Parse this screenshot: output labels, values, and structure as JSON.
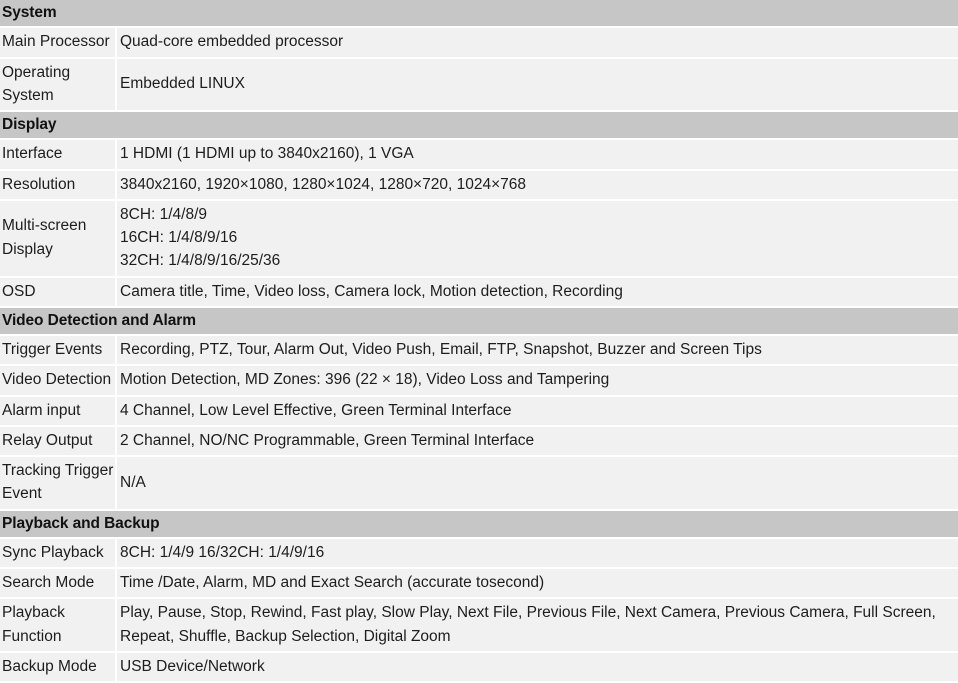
{
  "table": {
    "rows": [
      {
        "kind": "section",
        "title": "System"
      },
      {
        "kind": "data",
        "label": "Main Processor",
        "value": "Quad-core embedded processor"
      },
      {
        "kind": "data",
        "label": "Operating System",
        "value": "Embedded LINUX"
      },
      {
        "kind": "section",
        "title": "Display"
      },
      {
        "kind": "data",
        "label": "Interface",
        "value": "1 HDMI (1 HDMI up to 3840x2160), 1 VGA"
      },
      {
        "kind": "data",
        "label": "Resolution",
        "value": "3840x2160, 1920×1080, 1280×1024, 1280×720, 1024×768"
      },
      {
        "kind": "data",
        "label": "Multi-screen Display",
        "value": "8CH: 1/4/8/9\n16CH: 1/4/8/9/16\n32CH: 1/4/8/9/16/25/36"
      },
      {
        "kind": "data",
        "label": "OSD",
        "value": "Camera title, Time, Video loss, Camera lock, Motion detection, Recording"
      },
      {
        "kind": "section",
        "title": "Video Detection and Alarm"
      },
      {
        "kind": "data",
        "label": "Trigger Events",
        "value": "Recording, PTZ, Tour, Alarm Out, Video Push, Email, FTP, Snapshot, Buzzer and Screen Tips"
      },
      {
        "kind": "data",
        "label": "Video Detection",
        "value": "Motion Detection, MD Zones: 396 (22 × 18), Video Loss and Tampering"
      },
      {
        "kind": "data",
        "label": "Alarm input",
        "value": "4 Channel, Low Level Effective, Green Terminal Interface"
      },
      {
        "kind": "data",
        "label": "Relay Output",
        "value": "2 Channel, NO/NC Programmable, Green Terminal Interface"
      },
      {
        "kind": "data",
        "label": "Tracking Trigger Event",
        "value": "N/A"
      },
      {
        "kind": "section",
        "title": "Playback and Backup"
      },
      {
        "kind": "data",
        "label": "Sync Playback",
        "value": "8CH: 1/4/9 16/32CH: 1/4/9/16"
      },
      {
        "kind": "data",
        "label": "Search Mode",
        "value": "Time /Date, Alarm, MD and Exact Search (accurate tosecond)"
      },
      {
        "kind": "data",
        "label": "Playback Function",
        "value": "Play, Pause, Stop, Rewind, Fast play, Slow Play, Next File, Previous File, Next Camera, Previous Camera, Full Screen, Repeat, Shuffle, Backup Selection, Digital Zoom"
      },
      {
        "kind": "data",
        "label": "Backup Mode",
        "value": "USB Device/Network"
      }
    ]
  },
  "colors": {
    "section_header_bg": "#c6c6c6",
    "cell_bg": "#f1f1f1",
    "divider": "#ffffff",
    "text": "#1d1d1d"
  }
}
